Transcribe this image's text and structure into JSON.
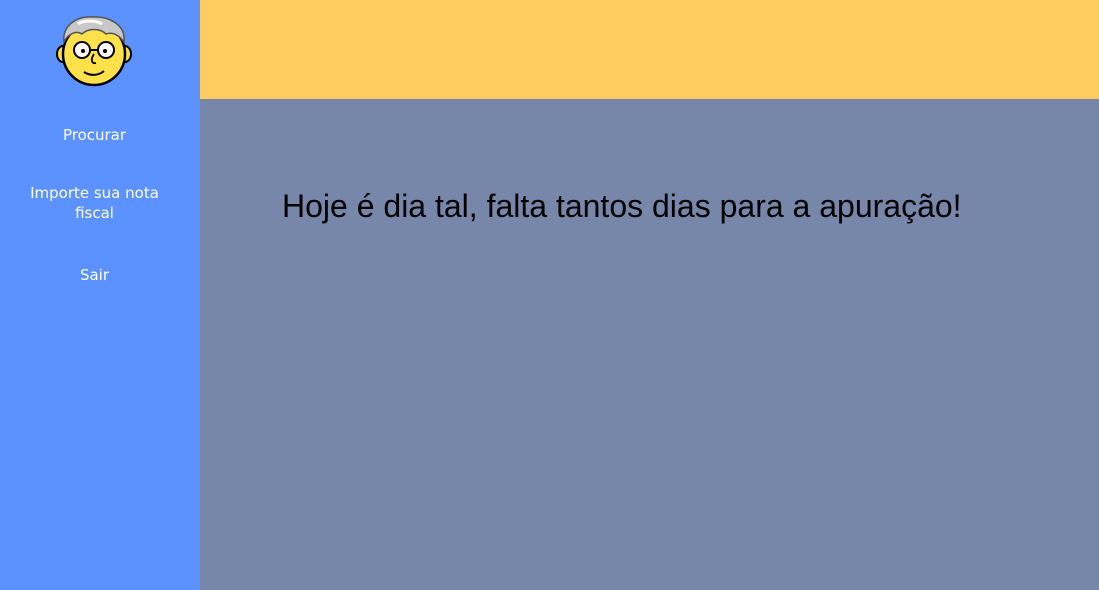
{
  "colors": {
    "sidebar_bg": "#5b92ff",
    "header_bg": "#ffcc5f",
    "main_bg": "#7787a9",
    "nav_text": "#ffffff",
    "headline_text": "#000000"
  },
  "sidebar": {
    "logo_icon": "cartoon-face-with-glasses-icon",
    "items": [
      {
        "label": "Procurar"
      },
      {
        "label": "Importe sua nota fiscal"
      },
      {
        "label": "Sair"
      }
    ]
  },
  "main": {
    "headline": "Hoje é dia tal, falta tantos dias para a apuração!"
  }
}
